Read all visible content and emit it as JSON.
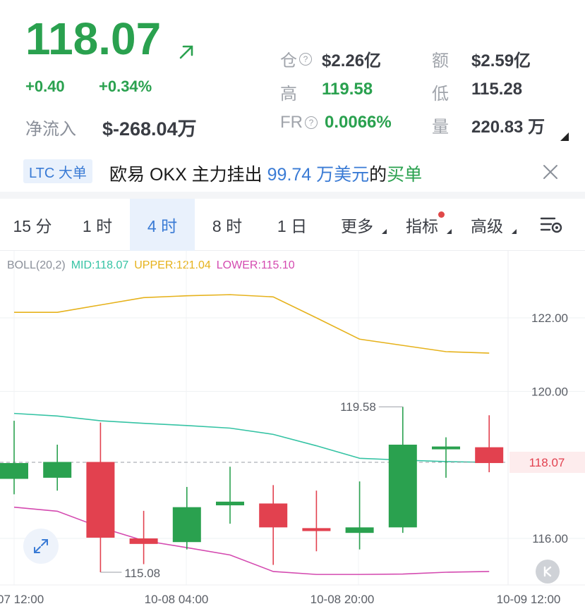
{
  "ticker": {
    "price": "118.07",
    "change": "+0.40",
    "change_pct": "+0.34%",
    "netflow_label": "净流入",
    "netflow_value": "$-268.04万",
    "colors": {
      "up": "#2aa14f",
      "down": "#e2414f",
      "accent": "#3a7bd5"
    }
  },
  "stats": {
    "open_interest_label": "仓",
    "open_interest_value": "$2.26亿",
    "amount_label": "额",
    "amount_value": "$2.59亿",
    "high_label": "高",
    "high_value": "119.58",
    "low_label": "低",
    "low_value": "115.28",
    "fr_label": "FR",
    "fr_value": "0.0066%",
    "volume_label": "量",
    "volume_value": "220.83 万"
  },
  "banner": {
    "tag": "LTC 大单",
    "text_prefix": "欧易 OKX 主力挂出 ",
    "amount": "99.74 万美元",
    "text_mid": "的",
    "side": "买单"
  },
  "tabs": [
    {
      "label": "15 分",
      "active": false
    },
    {
      "label": "1 时",
      "active": false
    },
    {
      "label": "4 时",
      "active": true
    },
    {
      "label": "8 时",
      "active": false
    },
    {
      "label": "1 日",
      "active": false
    },
    {
      "label": "更多",
      "active": false
    },
    {
      "label": "指标",
      "active": false
    },
    {
      "label": "高级",
      "active": false
    }
  ],
  "indicator": {
    "name": "BOLL(20,2)",
    "mid": "MID:118.07",
    "upper": "UPPER:121.04",
    "lower": "LOWER:115.10",
    "colors": {
      "mid": "#35c3a4",
      "upper": "#e6b21c",
      "lower": "#d44ab0"
    }
  },
  "chart_data": {
    "type": "candlestick",
    "y_ticks": [
      "122.00",
      "120.00",
      "116.00"
    ],
    "x_ticks": [
      "07 12:00",
      "10-08 04:00",
      "10-08 20:00",
      "10-09 12:00"
    ],
    "current_price_label": "118.07",
    "high_annotation": "119.58",
    "low_annotation": "115.08",
    "ylim": [
      115.0,
      123.6
    ],
    "candles": [
      {
        "open": 117.62,
        "close": 118.05,
        "high": 119.2,
        "low": 117.2
      },
      {
        "open": 117.65,
        "close": 118.08,
        "high": 118.55,
        "low": 117.3
      },
      {
        "open": 118.08,
        "close": 116.02,
        "high": 119.15,
        "low": 115.08
      },
      {
        "open": 116.0,
        "close": 115.85,
        "high": 116.75,
        "low": 115.3
      },
      {
        "open": 115.9,
        "close": 116.85,
        "high": 117.4,
        "low": 115.7
      },
      {
        "open": 116.9,
        "close": 117.0,
        "high": 117.95,
        "low": 116.4
      },
      {
        "open": 116.95,
        "close": 116.3,
        "high": 117.45,
        "low": 115.28
      },
      {
        "open": 116.28,
        "close": 116.2,
        "high": 117.3,
        "low": 115.65
      },
      {
        "open": 116.15,
        "close": 116.3,
        "high": 117.55,
        "low": 115.7
      },
      {
        "open": 116.3,
        "close": 118.55,
        "high": 119.58,
        "low": 116.15
      },
      {
        "open": 118.45,
        "close": 118.5,
        "high": 118.75,
        "low": 117.65
      },
      {
        "open": 118.48,
        "close": 118.05,
        "high": 119.35,
        "low": 117.8
      }
    ],
    "upper": [
      122.15,
      122.15,
      122.35,
      122.55,
      122.6,
      122.63,
      122.57,
      122.0,
      121.42,
      121.25,
      121.08,
      121.04
    ],
    "mid": [
      119.4,
      119.33,
      119.2,
      119.13,
      119.07,
      119.0,
      118.83,
      118.52,
      118.18,
      118.13,
      118.09,
      118.07
    ],
    "lower": [
      116.85,
      116.74,
      116.3,
      115.94,
      115.75,
      115.55,
      115.1,
      115.02,
      115.02,
      115.03,
      115.08,
      115.1
    ]
  }
}
